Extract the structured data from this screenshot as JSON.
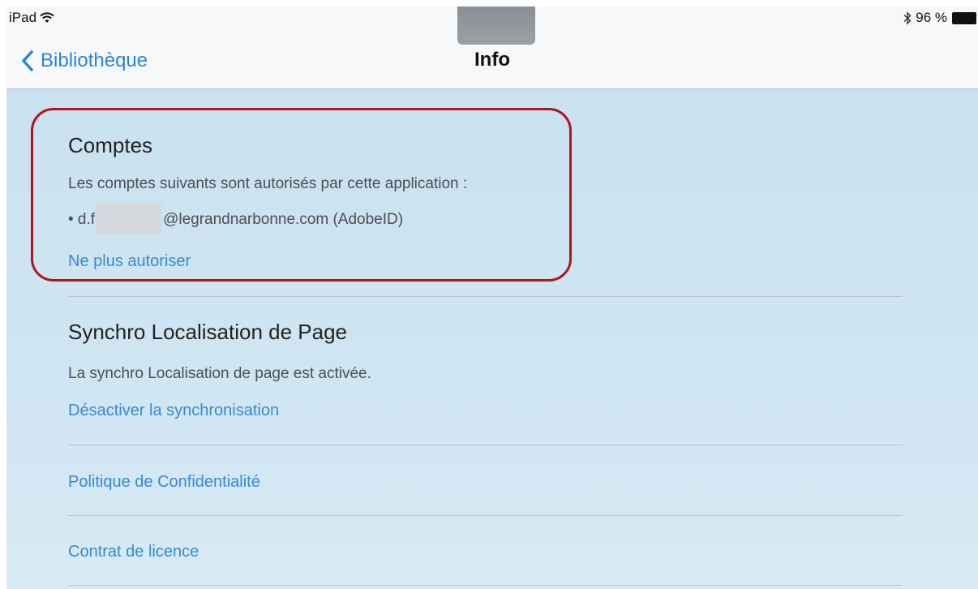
{
  "status_bar": {
    "device": "iPad",
    "battery_text": "96 %"
  },
  "nav": {
    "back_label": "Bibliothèque",
    "title": "Info"
  },
  "accounts": {
    "title": "Comptes",
    "description": "Les comptes suivants sont autorisés par cette application :",
    "account_prefix": "• d.f",
    "account_suffix": "@legrandnarbonne.com (AdobeID)",
    "action": "Ne plus autoriser"
  },
  "sync": {
    "title": "Synchro Localisation de Page",
    "description": "La synchro Localisation de page est activée.",
    "action": "Désactiver la synchronisation"
  },
  "links": {
    "privacy": "Politique de Confidentialité",
    "license": "Contrat de licence"
  },
  "colors": {
    "accent": "#3689d5",
    "annotation": "#b0151c"
  }
}
